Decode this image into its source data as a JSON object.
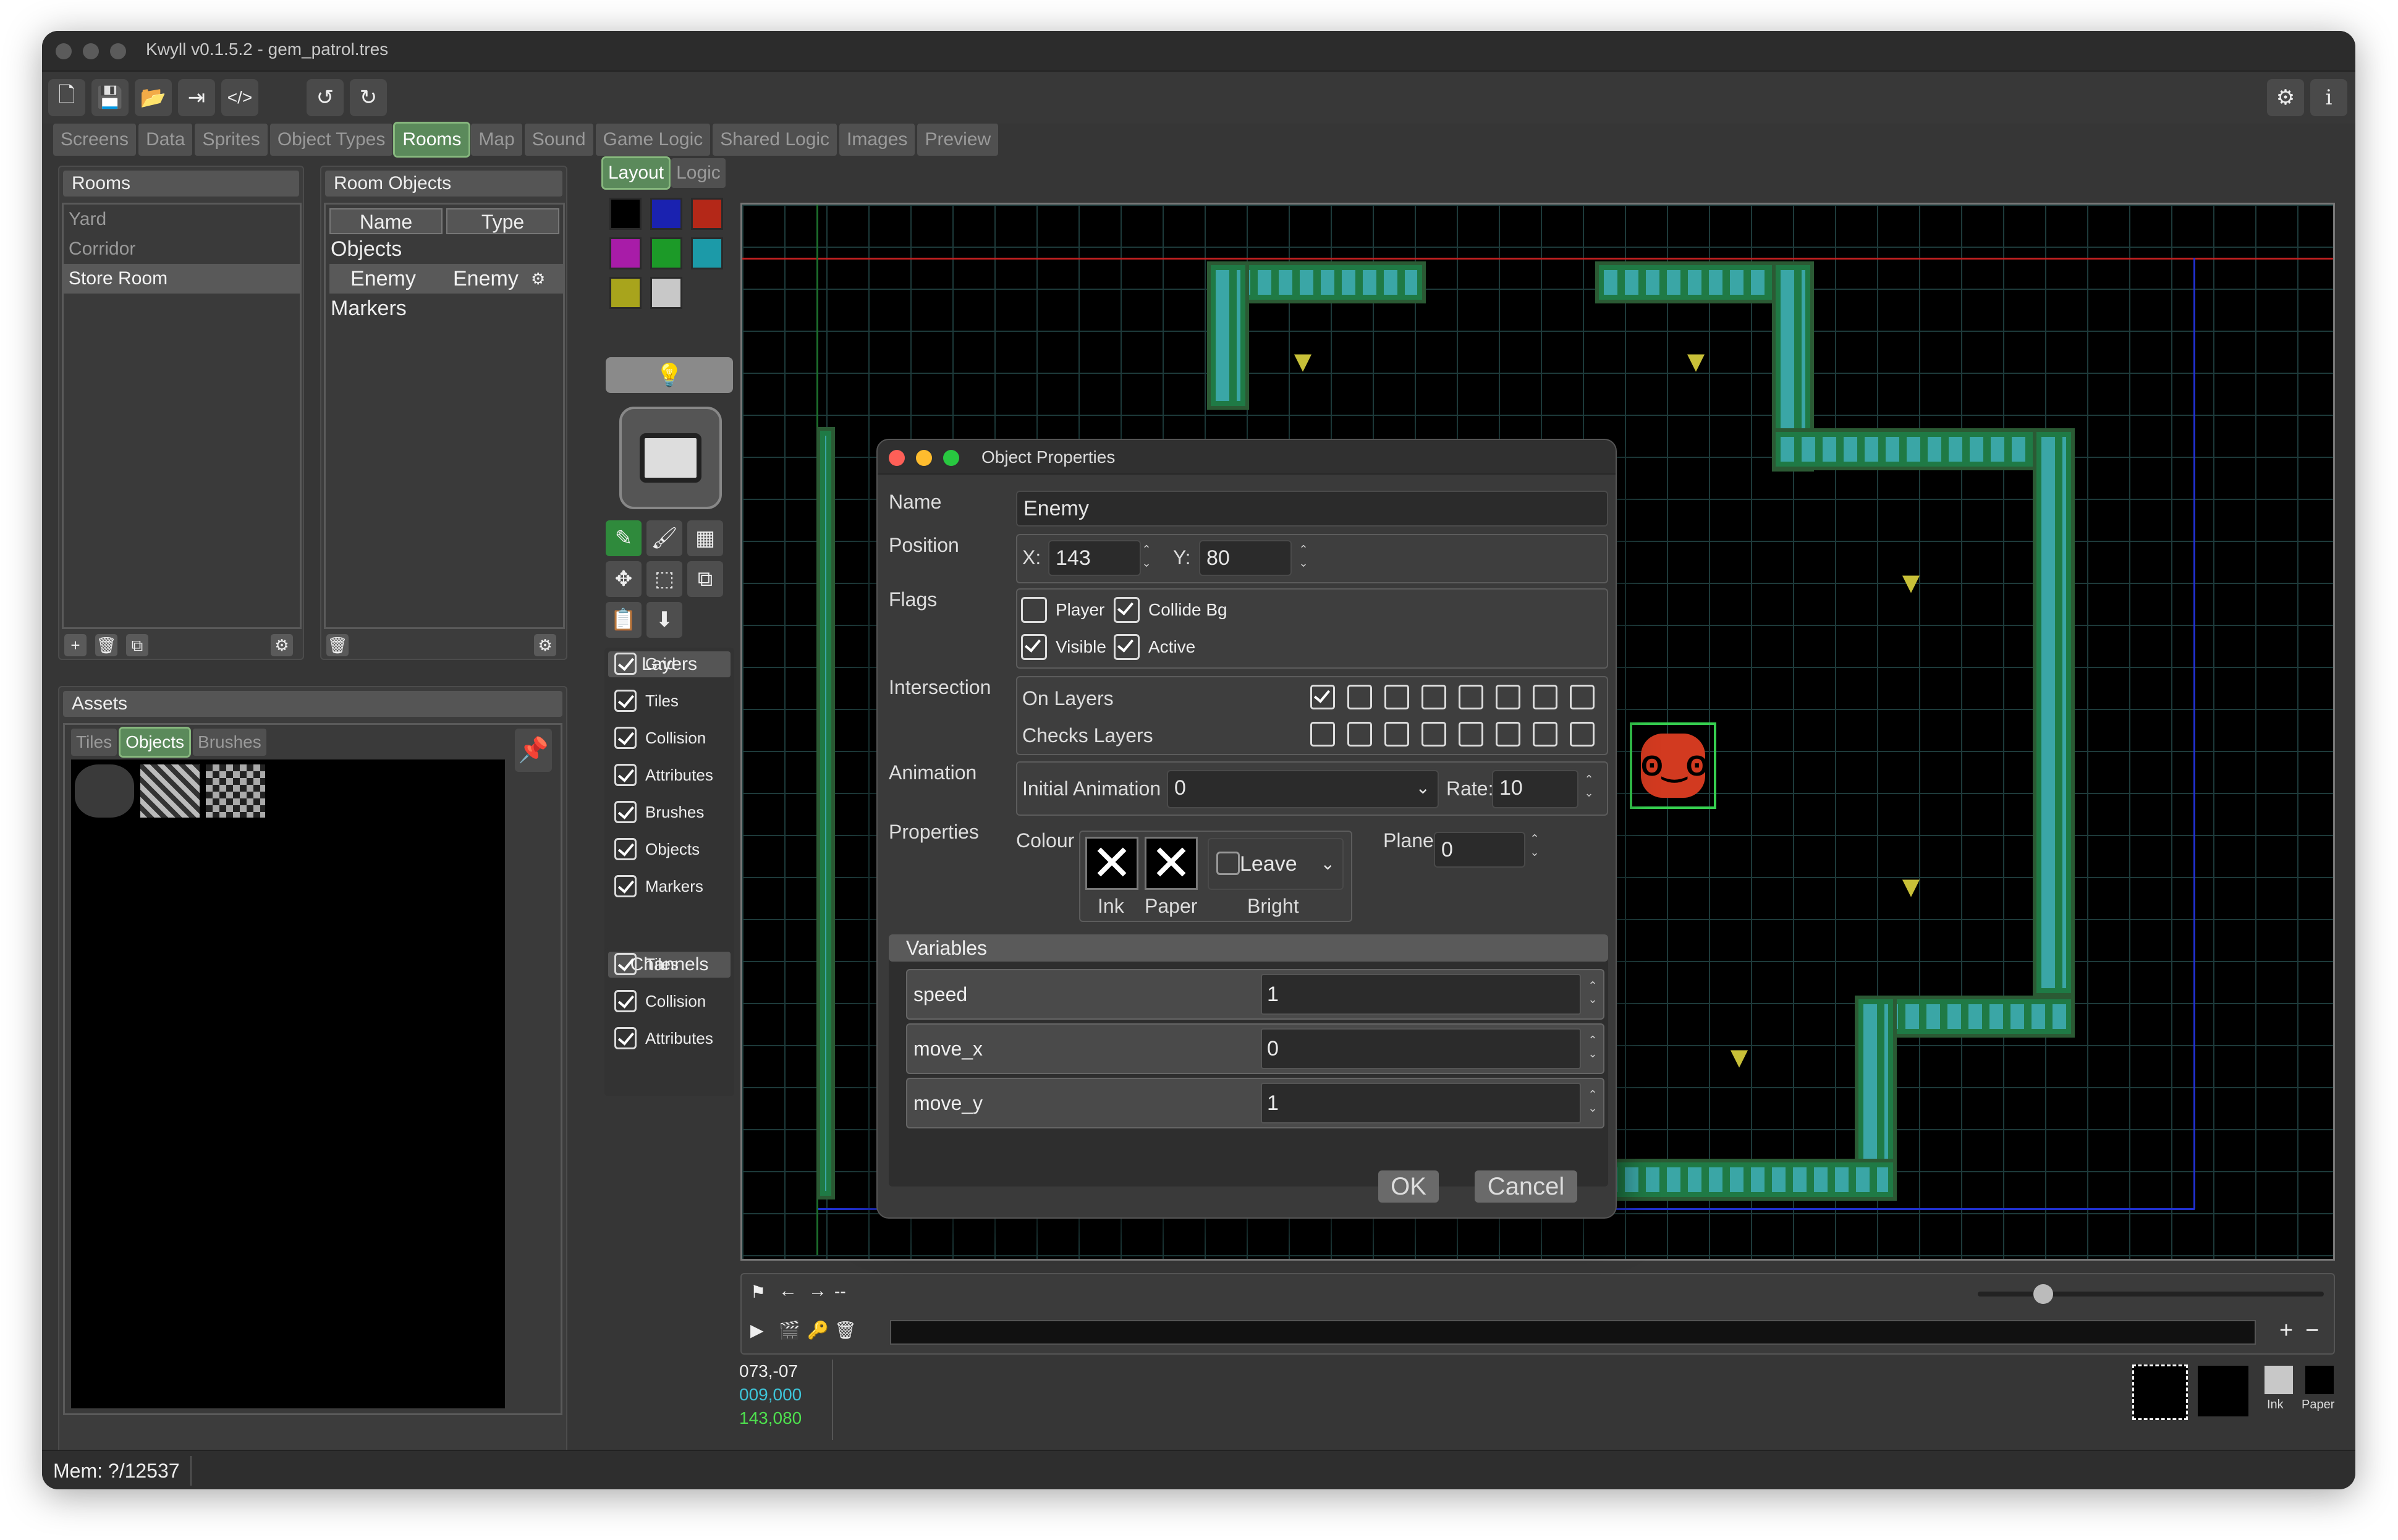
{
  "window": {
    "title": "Kwyll v0.1.5.2 - gem_patrol.tres"
  },
  "main_tabs": [
    "Screens",
    "Data",
    "Sprites",
    "Object Types",
    "Rooms",
    "Map",
    "Sound",
    "Game Logic",
    "Shared Logic",
    "Images",
    "Preview"
  ],
  "main_tab_selected": "Rooms",
  "rooms": {
    "header": "Rooms",
    "items": [
      "Yard",
      "Corridor",
      "Store Room"
    ],
    "selected": "Store Room"
  },
  "room_objects": {
    "header": "Room Objects",
    "col_name": "Name",
    "col_type": "Type",
    "groups": [
      "Objects",
      "Markers"
    ],
    "object": {
      "name": "Enemy",
      "type": "Enemy"
    }
  },
  "assets": {
    "header": "Assets",
    "tabs": [
      "Tiles",
      "Objects",
      "Brushes"
    ],
    "selected": "Objects"
  },
  "layout_tabs": [
    "Layout",
    "Logic"
  ],
  "palette_colors": [
    "#000000",
    "#1a22b0",
    "#b42818",
    "#a81ca8",
    "#1c9a28",
    "#1c9aa8",
    "#a8a41c",
    "#c8c8c8"
  ],
  "layers": {
    "header": "Layers",
    "items": [
      {
        "label": "Grid",
        "on": true
      },
      {
        "label": "Tiles",
        "on": true
      },
      {
        "label": "Collision",
        "on": true
      },
      {
        "label": "Attributes",
        "on": true
      },
      {
        "label": "Brushes",
        "on": true
      },
      {
        "label": "Objects",
        "on": true
      },
      {
        "label": "Markers",
        "on": true
      }
    ]
  },
  "channels": {
    "header": "Channels",
    "items": [
      {
        "label": "Tiles",
        "on": true
      },
      {
        "label": "Collision",
        "on": true
      },
      {
        "label": "Attributes",
        "on": true
      }
    ]
  },
  "dialog": {
    "title": "Object Properties",
    "name_label": "Name",
    "name_value": "Enemy",
    "position_label": "Position",
    "x_label": "X:",
    "x_value": "143",
    "y_label": "Y:",
    "y_value": "80",
    "flags_label": "Flags",
    "flags": [
      {
        "label": "Player",
        "on": false
      },
      {
        "label": "Collide Bg",
        "on": true
      },
      {
        "label": "Visible",
        "on": true
      },
      {
        "label": "Active",
        "on": true
      }
    ],
    "intersection_label": "Intersection",
    "on_layers_label": "On Layers",
    "checks_layers_label": "Checks Layers",
    "on_layers": [
      true,
      false,
      false,
      false,
      false,
      false,
      false,
      false
    ],
    "checks_layers": [
      false,
      false,
      false,
      false,
      false,
      false,
      false,
      false
    ],
    "animation_label": "Animation",
    "initial_animation_label": "Initial Animation",
    "initial_animation_value": "0",
    "rate_label": "Rate:",
    "rate_value": "10",
    "properties_label": "Properties",
    "colour_label": "Colour",
    "ink_label": "Ink",
    "paper_label": "Paper",
    "bright_label": "Bright",
    "bright_value": "Leave",
    "plane_label": "Plane",
    "plane_value": "0",
    "variables_header": "Variables",
    "variables": [
      {
        "name": "speed",
        "value": "1"
      },
      {
        "name": "move_x",
        "value": "0"
      },
      {
        "name": "move_y",
        "value": "1"
      }
    ],
    "ok_label": "OK",
    "cancel_label": "Cancel"
  },
  "coords": {
    "cursor": "073,-07",
    "pos_a": "009,000",
    "pos_b": "143,080"
  },
  "swatches": {
    "ink_label": "Ink",
    "paper_label": "Paper"
  },
  "timeline": {
    "frame_label": "--"
  },
  "status": {
    "mem": "Mem: ?/12537"
  },
  "icons": {
    "new": "new-file-icon",
    "save": "save-icon",
    "open": "open-folder-icon",
    "export": "export-icon",
    "code": "code-icon",
    "undo": "undo-icon",
    "redo": "redo-icon",
    "settings": "gear-icon",
    "info": "info-icon"
  }
}
